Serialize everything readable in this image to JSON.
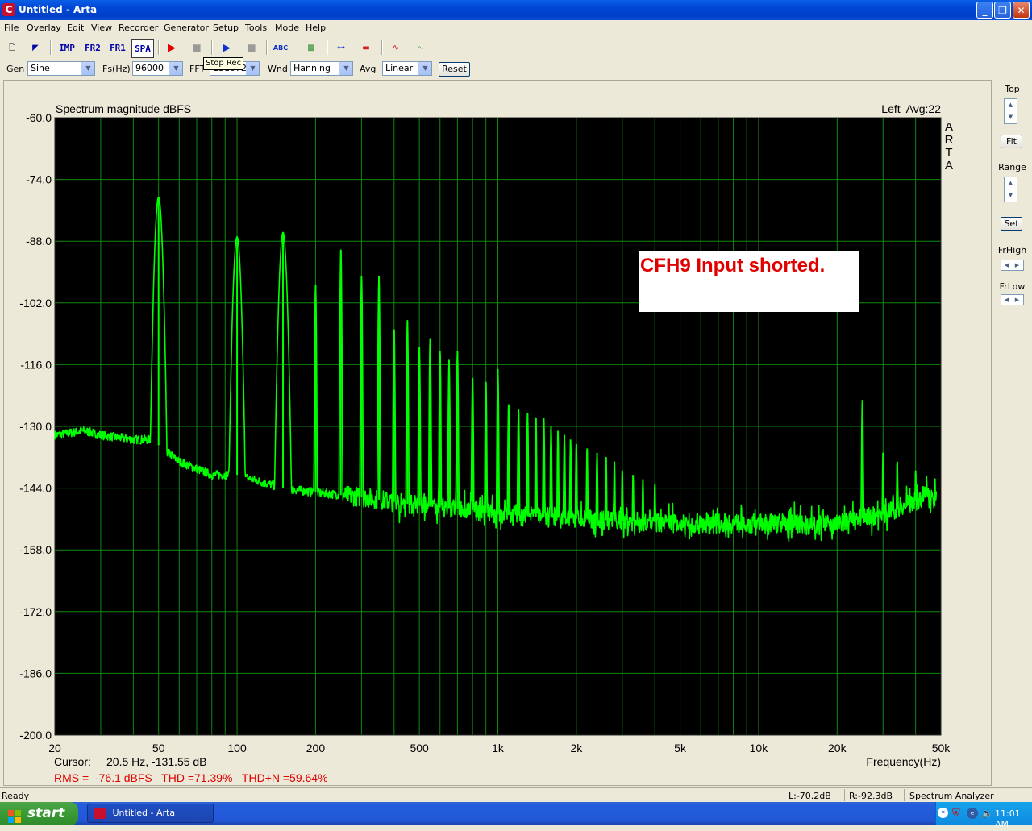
{
  "window": {
    "title": "Untitled - Arta",
    "app_icon_letter": "C"
  },
  "menu": [
    "File",
    "Overlay",
    "Edit",
    "View",
    "Recorder",
    "Generator",
    "Setup",
    "Tools",
    "Mode",
    "Help"
  ],
  "toolbar": {
    "imp_label": "IMP",
    "fr2_label": "FR2",
    "fr1_label": "FR1",
    "spa_label": "SPA",
    "tooltip": "Stop Rec"
  },
  "controls": {
    "gen_label": "Gen",
    "gen_value": "Sine",
    "fs_label": "Fs(Hz)",
    "fs_value": "96000",
    "fft_label": "FFT",
    "fft_value": "131072",
    "wnd_label": "Wnd",
    "wnd_value": "Hanning",
    "avg_label": "Avg",
    "avg_value": "Linear",
    "reset_label": "Reset"
  },
  "right_panel": {
    "top_label": "Top",
    "fit_label": "Fit",
    "range_label": "Range",
    "set_label": "Set",
    "frhigh_label": "FrHigh",
    "frlow_label": "FrLow"
  },
  "chart_data": {
    "type": "line",
    "title": "Spectrum magnitude dBFS",
    "channel_info": "Left  Avg:22",
    "watermark": "ARTA",
    "annotation": "CFH9 Input shorted.",
    "xlabel": "Frequency(Hz)",
    "x_scale": "log",
    "xlim": [
      20,
      50000
    ],
    "ylim": [
      -200,
      -60
    ],
    "y_ticks": [
      "-60.0",
      "-74.0",
      "-88.0",
      "-102.0",
      "-116.0",
      "-130.0",
      "-144.0",
      "-158.0",
      "-172.0",
      "-186.0",
      "-200.0"
    ],
    "x_tick_values": [
      20,
      50,
      100,
      200,
      500,
      1000,
      2000,
      5000,
      10000,
      20000,
      50000
    ],
    "x_ticks": [
      "20",
      "50",
      "100",
      "200",
      "500",
      "1k",
      "2k",
      "5k",
      "10k",
      "20k",
      "50k"
    ],
    "background": "#000000",
    "grid_color": "#0E8A0E",
    "trace_color": "#00FF00",
    "grid": true,
    "series": [
      {
        "noise_floor": [
          [
            20,
            -132
          ],
          [
            26,
            -131
          ],
          [
            30,
            -132
          ],
          [
            40,
            -133
          ],
          [
            47,
            -133
          ],
          [
            60,
            -138
          ],
          [
            80,
            -141
          ],
          [
            100,
            -141
          ],
          [
            150,
            -144
          ],
          [
            200,
            -145
          ],
          [
            300,
            -146
          ],
          [
            500,
            -148
          ],
          [
            800,
            -149
          ],
          [
            1000,
            -150
          ],
          [
            2000,
            -151
          ],
          [
            5000,
            -152
          ],
          [
            10000,
            -152
          ],
          [
            15000,
            -152
          ],
          [
            20000,
            -152
          ],
          [
            30000,
            -150
          ],
          [
            40000,
            -147
          ],
          [
            45000,
            -145
          ],
          [
            48000,
            -146
          ]
        ],
        "peaks": [
          [
            50,
            -78
          ],
          [
            100,
            -87
          ],
          [
            150,
            -86
          ],
          [
            200,
            -98
          ],
          [
            250,
            -90
          ],
          [
            300,
            -96
          ],
          [
            350,
            -96
          ],
          [
            400,
            -108
          ],
          [
            450,
            -106
          ],
          [
            500,
            -112
          ],
          [
            550,
            -110
          ],
          [
            600,
            -113
          ],
          [
            650,
            -115
          ],
          [
            700,
            -113
          ],
          [
            800,
            -119
          ],
          [
            900,
            -120
          ],
          [
            1000,
            -117
          ],
          [
            1100,
            -125
          ],
          [
            1200,
            -126
          ],
          [
            1300,
            -127
          ],
          [
            1400,
            -128
          ],
          [
            1500,
            -128
          ],
          [
            1600,
            -130
          ],
          [
            1700,
            -131
          ],
          [
            1800,
            -132
          ],
          [
            1900,
            -133
          ],
          [
            2000,
            -134
          ],
          [
            2200,
            -135
          ],
          [
            2400,
            -136
          ],
          [
            2600,
            -137
          ],
          [
            2800,
            -138
          ],
          [
            3000,
            -140
          ],
          [
            3300,
            -141
          ],
          [
            3600,
            -142
          ],
          [
            4000,
            -143
          ],
          [
            25000,
            -124
          ],
          [
            30000,
            -136
          ],
          [
            34000,
            -138
          ],
          [
            40000,
            -140
          ]
        ]
      }
    ]
  },
  "readouts": {
    "cursor_label": "Cursor:",
    "cursor_value": "20.5 Hz, -131.55 dB",
    "rms_line": "RMS =  -76.1 dBFS   THD =71.39%   THD+N =59.64%"
  },
  "status": {
    "ready": "Ready",
    "left_level": "L:-70.2dB",
    "right_level": "R:-92.3dB",
    "mode": "Spectrum Analyzer"
  },
  "taskbar": {
    "start_label": "start",
    "task_label": "Untitled - Arta",
    "clock": "11:01 AM"
  }
}
